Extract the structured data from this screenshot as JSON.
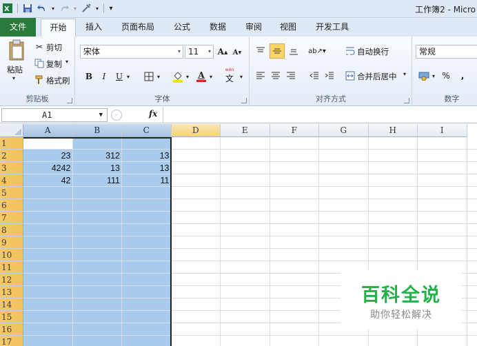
{
  "title_bar": {
    "text": "工作簿2 - Micro"
  },
  "tabs": [
    {
      "label": "文件"
    },
    {
      "label": "开始"
    },
    {
      "label": "插入"
    },
    {
      "label": "页面布局"
    },
    {
      "label": "公式"
    },
    {
      "label": "数据"
    },
    {
      "label": "审阅"
    },
    {
      "label": "视图"
    },
    {
      "label": "开发工具"
    }
  ],
  "ribbon": {
    "clipboard": {
      "paste": "粘贴",
      "cut": "剪切",
      "copy": "复制",
      "format_painter": "格式刷",
      "label": "剪贴板"
    },
    "font": {
      "name": "宋体",
      "size": "11",
      "bold": "B",
      "italic": "I",
      "underline": "U",
      "label": "字体",
      "wen": "文"
    },
    "alignment": {
      "wrap": "自动换行",
      "merge": "合并后居中",
      "label": "对齐方式"
    },
    "number": {
      "format": "常规",
      "percent": "%",
      "comma": ",",
      "label": "数字"
    }
  },
  "formula_bar": {
    "name_box": "A1",
    "fx": "fx",
    "value": ""
  },
  "sheet": {
    "columns": [
      "A",
      "B",
      "C",
      "D",
      "E",
      "F",
      "G",
      "H",
      "I"
    ],
    "rows": [
      "1",
      "2",
      "3",
      "4",
      "5",
      "6",
      "7",
      "8",
      "9",
      "10",
      "11",
      "12",
      "13",
      "14",
      "15",
      "16",
      "17"
    ],
    "data": [
      [
        "",
        "",
        ""
      ],
      [
        "23",
        "312",
        "13"
      ],
      [
        "4242",
        "13",
        "13"
      ],
      [
        "42",
        "111",
        "11"
      ]
    ]
  },
  "watermark": {
    "title": "百科全说",
    "subtitle": "助你轻松解决"
  },
  "colors": {
    "file_tab": "#2a7a3b",
    "selection": "#a9cbec",
    "row_header": "#f2c15b",
    "watermark_green": "#23b24a"
  }
}
